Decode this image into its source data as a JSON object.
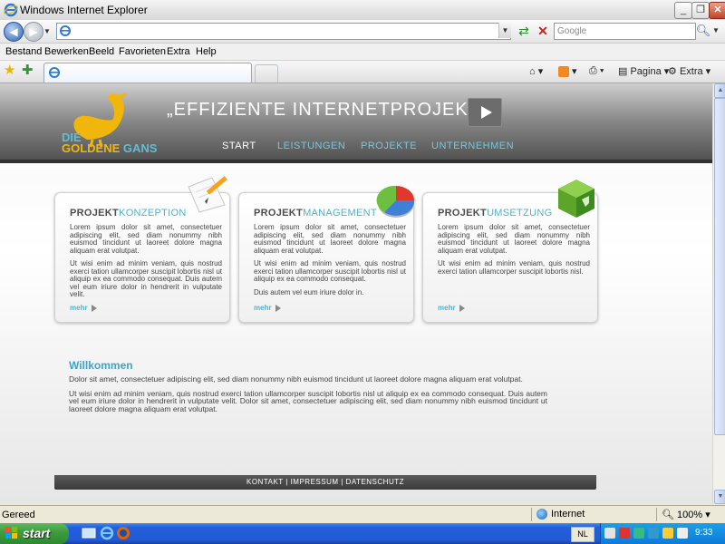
{
  "window": {
    "title": "Windows Internet Explorer",
    "minimize_glyph": "_",
    "maximize_glyph": "❐",
    "close_glyph": "✕"
  },
  "addressbar": {
    "url": "",
    "search_placeholder": "Google"
  },
  "menu": {
    "items": [
      "Bestand",
      "Bewerken",
      "Beeld",
      "Favorieten",
      "Extra",
      "Help"
    ]
  },
  "tabbar": {
    "tab_title": "",
    "commands": {
      "page": "Pagina",
      "tools": "Extra"
    }
  },
  "site": {
    "logo": {
      "line1": "DIE",
      "line2a": "GOLDENE",
      "line2b": "GANS"
    },
    "slogan": "„EFFIZIENTE  INTERNETPROJEKTE“",
    "nav": [
      "START",
      "LEISTUNGEN",
      "PROJEKTE",
      "UNTERNEHMEN"
    ],
    "cards": [
      {
        "title_a": "PROJEKT",
        "title_b": "KONZEPTION",
        "p1": "Lorem ipsum dolor sit amet, consectetuer adipiscing elit, sed diam nonummy nibh euismod tincidunt ut laoreet dolore magna aliquam erat volutpat.",
        "p2": "Ut wisi enim ad minim veniam, quis nostrud exerci tation ullamcorper suscipit lobortis nisl ut aliquip ex ea commodo consequat. Duis autem vel eum iriure dolor in hendrerit in vulputate velit.",
        "p3": "",
        "more": "mehr"
      },
      {
        "title_a": "PROJEKT",
        "title_b": "MANAGEMENT",
        "p1": "Lorem ipsum dolor sit amet, consectetuer adipiscing elit, sed diam nonummy nibh euismod tincidunt ut laoreet dolore magna aliquam erat volutpat.",
        "p2": "Ut wisi enim ad minim veniam, quis nostrud exerci tation ullamcorper suscipit lobortis nisl ut aliquip ex ea commodo consequat.",
        "p3": "Duis autem vel eum iriure dolor in.",
        "more": "mehr"
      },
      {
        "title_a": "PROJEKT",
        "title_b": "UMSETZUNG",
        "p1": "Lorem ipsum dolor sit amet, consectetuer adipiscing elit, sed diam nonummy nibh euismod tincidunt ut laoreet dolore magna aliquam erat volutpat.",
        "p2": "Ut wisi enim ad minim veniam, quis nostrud exerci tation ullamcorper suscipit lobortis nisl.",
        "p3": "",
        "more": "mehr"
      }
    ],
    "welcome": {
      "title": "Willkommen",
      "p1": "Dolor sit amet, consectetuer adipiscing elit, sed diam nonummy nibh euismod tincidunt ut laoreet dolore magna aliquam erat volutpat.",
      "p2": "Ut wisi enim ad minim veniam, quis nostrud exerci tation ullamcorper suscipit lobortis nisl ut aliquip ex ea commodo consequat. Duis autem vel eum iriure dolor in hendrerit in vulputate velit. Dolor sit amet, consectetuer adipiscing elit, sed diam nonummy nibh euismod tincidunt ut laoreet dolore magna aliquam erat volutpat."
    },
    "footer": "KONTAKT  |  IMPRESSUM  |  DATENSCHUTZ"
  },
  "statusbar": {
    "status": "Gereed",
    "zone": "Internet",
    "zoom": "100%"
  },
  "taskbar": {
    "start": "start",
    "language": "NL",
    "clock": "9:33"
  },
  "colors": {
    "accent_cyan": "#4fb3cf",
    "logo_gold": "#f1b60b",
    "xp_blue": "#245edc",
    "start_green": "#3c9b3c"
  }
}
